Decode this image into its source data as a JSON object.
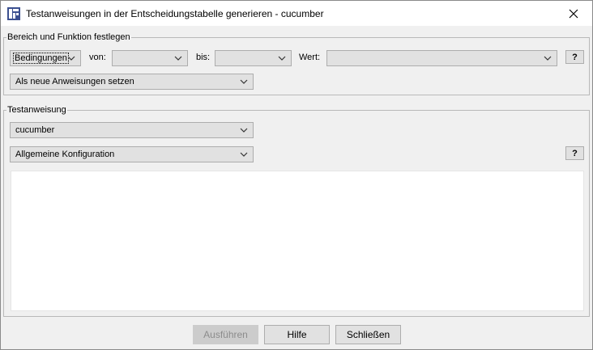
{
  "window": {
    "title": "Testanweisungen in der Entscheidungstabelle generieren - cucumber",
    "close_icon": "close-icon"
  },
  "scope": {
    "legend": "Bereich und Funktion festlegen",
    "type_select": "Bedingungen",
    "from_label": "von:",
    "from_value": "",
    "to_label": "bis:",
    "to_value": "",
    "value_label": "Wert:",
    "value_value": "",
    "help_label": "?",
    "mode_select": "Als neue Anweisungen setzen"
  },
  "statement": {
    "legend": "Testanweisung",
    "generator_select": "cucumber",
    "config_select": "Allgemeine Konfiguration",
    "help_label": "?",
    "editor_text": ""
  },
  "buttons": {
    "run": "Ausführen",
    "help": "Hilfe",
    "close": "Schließen"
  },
  "colors": {
    "window_bg": "#f0f0f0",
    "control_bg": "#e1e1e1",
    "control_border": "#adadad",
    "disabled_text": "#8c8c8c",
    "app_icon": "#3b4f8f"
  }
}
